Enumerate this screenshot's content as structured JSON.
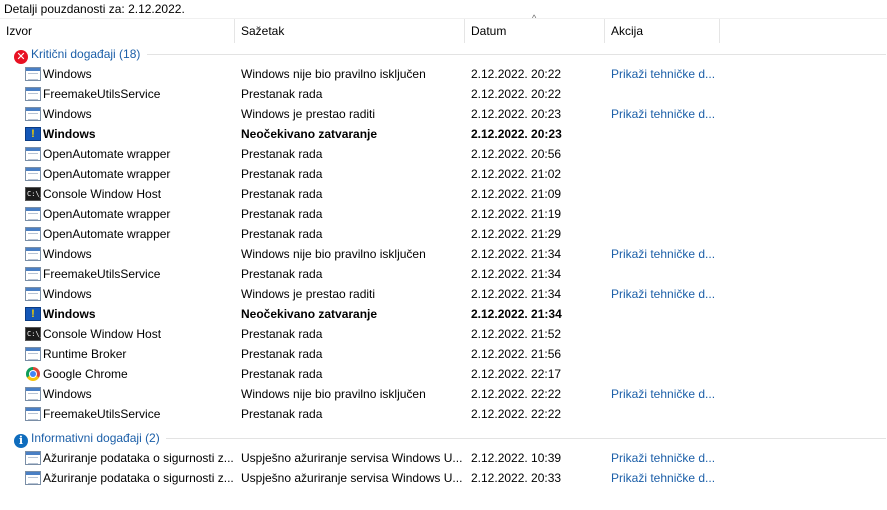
{
  "title": "Detalji pouzdanosti za: 2.12.2022.",
  "columns": {
    "source": "Izvor",
    "summary": "Sažetak",
    "date": "Datum",
    "action": "Akcija"
  },
  "groups": {
    "critical": {
      "label": "Kritični događaji (18)"
    },
    "info": {
      "label": "Informativni događaji (2)"
    }
  },
  "rows": [
    {
      "icon": "app-icon",
      "source": "Windows",
      "summary": "Windows nije bio pravilno isključen",
      "date": "2.12.2022. 20:22",
      "action": "Prikaži tehničke d..."
    },
    {
      "icon": "app-icon",
      "source": "FreemakeUtilsService",
      "summary": "Prestanak rada",
      "date": "2.12.2022. 20:22",
      "action": ""
    },
    {
      "icon": "app-icon",
      "source": "Windows",
      "summary": "Windows je prestao raditi",
      "date": "2.12.2022. 20:23",
      "action": "Prikaži tehničke d..."
    },
    {
      "icon": "warning-app-icon",
      "source": "Windows",
      "summary": "Neočekivano zatvaranje",
      "date": "2.12.2022. 20:23",
      "action": "",
      "bold": true
    },
    {
      "icon": "app-icon",
      "source": "OpenAutomate wrapper",
      "summary": "Prestanak rada",
      "date": "2.12.2022. 20:56",
      "action": ""
    },
    {
      "icon": "app-icon",
      "source": "OpenAutomate wrapper",
      "summary": "Prestanak rada",
      "date": "2.12.2022. 21:02",
      "action": ""
    },
    {
      "icon": "console-icon",
      "source": "Console Window Host",
      "summary": "Prestanak rada",
      "date": "2.12.2022. 21:09",
      "action": ""
    },
    {
      "icon": "app-icon",
      "source": "OpenAutomate wrapper",
      "summary": "Prestanak rada",
      "date": "2.12.2022. 21:19",
      "action": ""
    },
    {
      "icon": "app-icon",
      "source": "OpenAutomate wrapper",
      "summary": "Prestanak rada",
      "date": "2.12.2022. 21:29",
      "action": ""
    },
    {
      "icon": "app-icon",
      "source": "Windows",
      "summary": "Windows nije bio pravilno isključen",
      "date": "2.12.2022. 21:34",
      "action": "Prikaži tehničke d..."
    },
    {
      "icon": "app-icon",
      "source": "FreemakeUtilsService",
      "summary": "Prestanak rada",
      "date": "2.12.2022. 21:34",
      "action": ""
    },
    {
      "icon": "app-icon",
      "source": "Windows",
      "summary": "Windows je prestao raditi",
      "date": "2.12.2022. 21:34",
      "action": "Prikaži tehničke d..."
    },
    {
      "icon": "warning-app-icon",
      "source": "Windows",
      "summary": "Neočekivano zatvaranje",
      "date": "2.12.2022. 21:34",
      "action": "",
      "bold": true
    },
    {
      "icon": "console-icon",
      "source": "Console Window Host",
      "summary": "Prestanak rada",
      "date": "2.12.2022. 21:52",
      "action": ""
    },
    {
      "icon": "app-icon",
      "source": "Runtime Broker",
      "summary": "Prestanak rada",
      "date": "2.12.2022. 21:56",
      "action": ""
    },
    {
      "icon": "chrome-icon",
      "source": "Google Chrome",
      "summary": "Prestanak rada",
      "date": "2.12.2022. 22:17",
      "action": ""
    },
    {
      "icon": "app-icon",
      "source": "Windows",
      "summary": "Windows nije bio pravilno isključen",
      "date": "2.12.2022. 22:22",
      "action": "Prikaži tehničke d..."
    },
    {
      "icon": "app-icon",
      "source": "FreemakeUtilsService",
      "summary": "Prestanak rada",
      "date": "2.12.2022. 22:22",
      "action": ""
    }
  ],
  "info_rows": [
    {
      "icon": "app-icon",
      "source": "Ažuriranje podataka o sigurnosti z...",
      "summary": "Uspješno ažuriranje servisa Windows U...",
      "date": "2.12.2022. 10:39",
      "action": "Prikaži tehničke d..."
    },
    {
      "icon": "app-icon",
      "source": "Ažuriranje podataka o sigurnosti z...",
      "summary": "Uspješno ažuriranje servisa Windows U...",
      "date": "2.12.2022. 20:33",
      "action": "Prikaži tehničke d..."
    }
  ],
  "colors": {
    "link": "#1c5fa8",
    "critical": "#e81123",
    "info": "#0f6cbd"
  }
}
